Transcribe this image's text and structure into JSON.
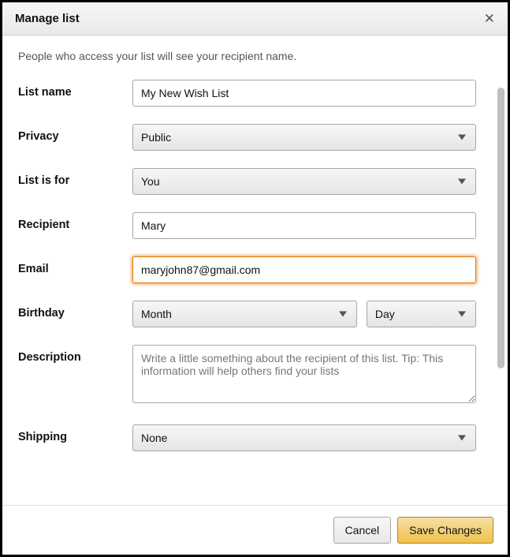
{
  "header": {
    "title": "Manage list"
  },
  "info_text": "People who access your list will see your recipient name.",
  "labels": {
    "list_name": "List name",
    "privacy": "Privacy",
    "list_is_for": "List is for",
    "recipient": "Recipient",
    "email": "Email",
    "birthday": "Birthday",
    "description": "Description",
    "shipping": "Shipping"
  },
  "fields": {
    "list_name": "My New Wish List",
    "privacy": "Public",
    "list_is_for": "You",
    "recipient": "Mary",
    "email": "maryjohn87@gmail.com",
    "birthday_month": "Month",
    "birthday_day": "Day",
    "description_placeholder": "Write a little something about the recipient of this list. Tip: This information will help others find your lists",
    "shipping": "None"
  },
  "footer": {
    "cancel": "Cancel",
    "save": "Save Changes"
  }
}
